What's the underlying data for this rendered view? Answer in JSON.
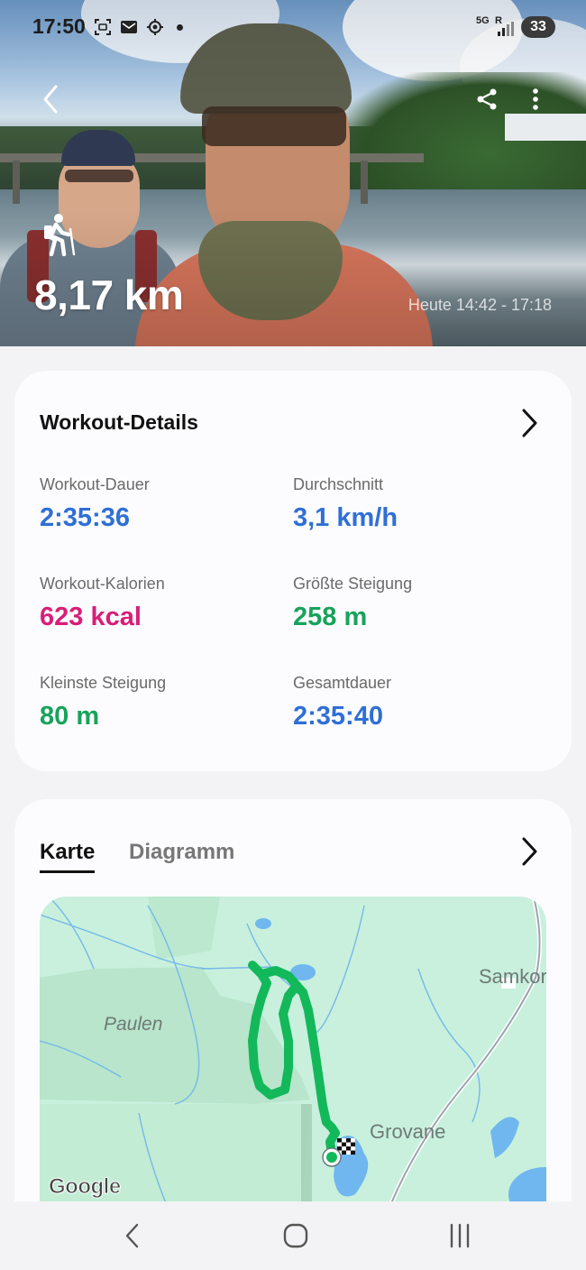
{
  "status_bar": {
    "time": "17:50",
    "icons": [
      "screenshot-icon",
      "mail-icon",
      "location-icon"
    ],
    "network": "5G",
    "roaming": "R",
    "battery": "33"
  },
  "hero": {
    "activity_icon": "hiking-icon",
    "distance": "8,17 km",
    "time_range": "Heute 14:42 - 17:18",
    "actions": [
      "back-icon",
      "share-icon",
      "more-icon"
    ]
  },
  "workout_details": {
    "title": "Workout-Details",
    "stats": [
      {
        "label": "Workout-Dauer",
        "value": "2:35:36",
        "color": "#2f6fd6"
      },
      {
        "label": "Durchschnitt",
        "value": "3,1 km/h",
        "color": "#2f6fd6"
      },
      {
        "label": "Workout-Kalorien",
        "value": "623 kcal",
        "color": "#d81e78"
      },
      {
        "label": "Größte Steigung",
        "value": "258 m",
        "color": "#18a35c"
      },
      {
        "label": "Kleinste Steigung",
        "value": "80 m",
        "color": "#18a35c"
      },
      {
        "label": "Gesamtdauer",
        "value": "2:35:40",
        "color": "#2f6fd6"
      }
    ]
  },
  "map_section": {
    "tabs": [
      {
        "label": "Karte",
        "active": true
      },
      {
        "label": "Diagramm",
        "active": false
      }
    ],
    "map_labels": {
      "paulen": "Paulen",
      "grovane": "Grovane",
      "samkor": "Samkor"
    },
    "attribution": "Google",
    "route_color": "#12b85a"
  },
  "nav_bar": {
    "buttons": [
      "nav-back-icon",
      "nav-home-icon",
      "nav-recents-icon"
    ]
  }
}
